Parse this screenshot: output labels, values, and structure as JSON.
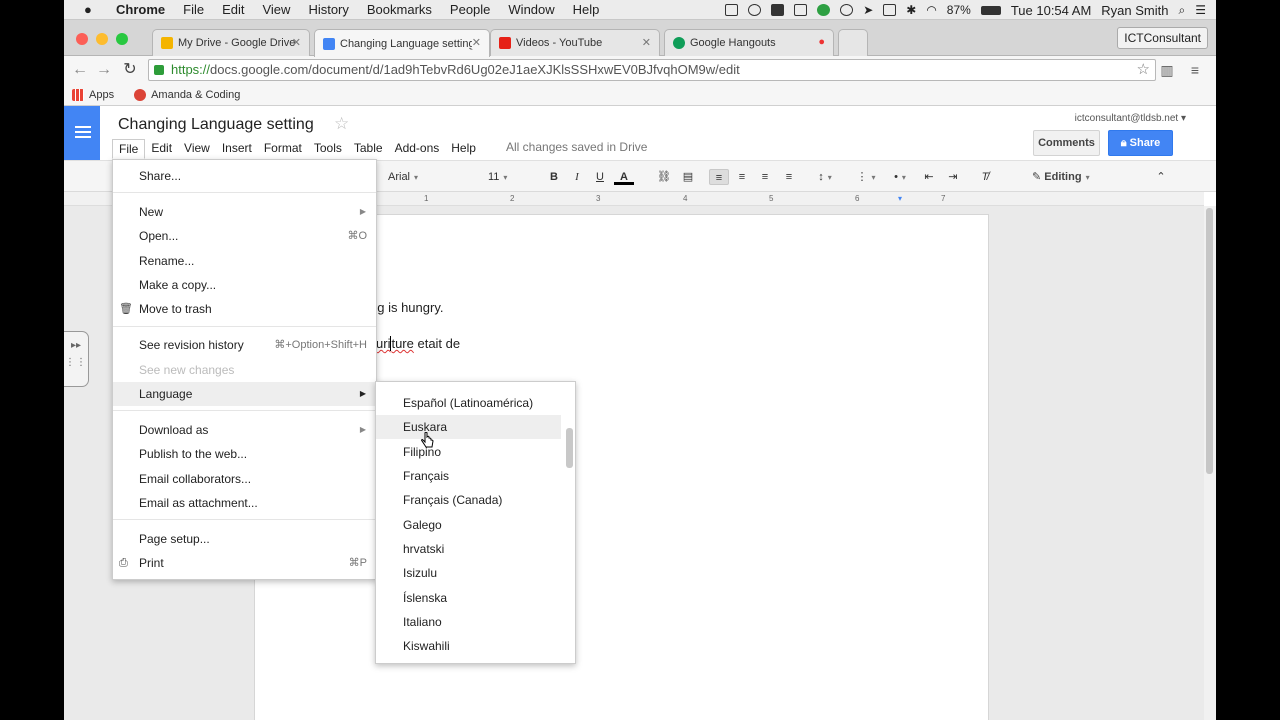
{
  "mac_menubar": {
    "app": "Chrome",
    "items": [
      "File",
      "Edit",
      "View",
      "History",
      "Bookmarks",
      "People",
      "Window",
      "Help"
    ],
    "battery": "87%",
    "clock": "Tue 10:54 AM",
    "user": "Ryan Smith"
  },
  "tabs": [
    {
      "label": "My Drive - Google Drive",
      "color": "#f4b400"
    },
    {
      "label": "Changing Language setting",
      "color": "#4285f4"
    },
    {
      "label": "Videos - YouTube",
      "color": "#e62117"
    },
    {
      "label": "Google Hangouts",
      "color": "#0f9d58"
    }
  ],
  "profile": "ICTConsultant",
  "url": {
    "scheme": "https://",
    "rest": "docs.google.com/document/d/1ad9hTebvRd6Ug02eJ1aeXJKlsSSHxwEV0BJfvqhOM9w/edit"
  },
  "bookmarks": [
    "Apps",
    "Amanda & Coding"
  ],
  "doc": {
    "title": "Changing Language setting",
    "menu": [
      "File",
      "Edit",
      "View",
      "Insert",
      "Format",
      "Tools",
      "Table",
      "Add-ons",
      "Help"
    ],
    "saved_status": "All changes saved in Drive",
    "account": "ictconsultant@tldsb.net",
    "comments_label": "Comments",
    "share_label": "Share"
  },
  "format_toolbar": {
    "font": "Arial",
    "size": "11",
    "mode": "Editing"
  },
  "ruler": [
    "1",
    "2",
    "3",
    "4",
    "5",
    "6",
    "7"
  ],
  "body_text": {
    "line1": "og is hungry.",
    "line2a": "u",
    "line2b": "ri",
    "line2c": "ture",
    "line2d": " etait de"
  },
  "file_menu": {
    "share": "Share...",
    "new": "New",
    "open": "Open...",
    "open_sc": "⌘O",
    "rename": "Rename...",
    "copy": "Make a copy...",
    "trash": "Move to trash",
    "revision": "See revision history",
    "revision_sc": "⌘+Option+Shift+H",
    "new_changes": "See new changes",
    "language": "Language",
    "download": "Download as",
    "publish": "Publish to the web...",
    "email_collab": "Email collaborators...",
    "email_attach": "Email as attachment...",
    "page_setup": "Page setup...",
    "print": "Print",
    "print_sc": "⌘P"
  },
  "language_menu": [
    "Español (Latinoamérica)",
    "Euskara",
    "Filipino",
    "Français",
    "Français (Canada)",
    "Galego",
    "hrvatski",
    "Isizulu",
    "Íslenska",
    "Italiano",
    "Kiswahili"
  ]
}
